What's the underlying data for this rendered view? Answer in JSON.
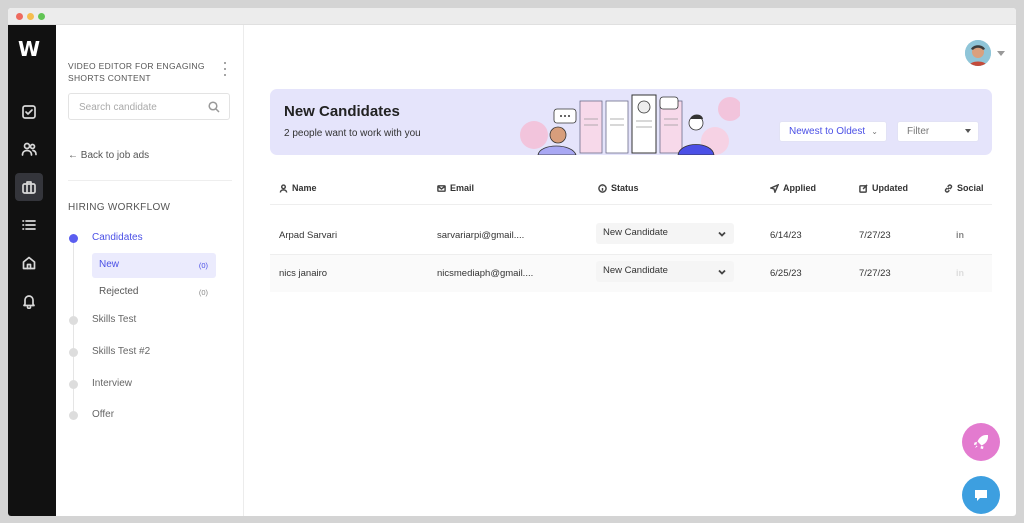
{
  "window": {
    "traffic_colors": [
      "#ee6a5f",
      "#f5bd4f",
      "#61c454"
    ]
  },
  "rail": {
    "logo": "W",
    "items": [
      {
        "icon": "checkbox-icon"
      },
      {
        "icon": "users-icon"
      },
      {
        "icon": "briefcase-icon",
        "active": true
      },
      {
        "icon": "list-icon"
      },
      {
        "icon": "home-icon"
      },
      {
        "icon": "bell-icon"
      }
    ]
  },
  "sidebar": {
    "job_title": "VIDEO EDITOR FOR ENGAGING SHORTS CONTENT",
    "search_placeholder": "Search candidate",
    "back_label": "Back to job ads",
    "workflow_heading": "HIRING WORKFLOW",
    "stages": [
      {
        "label": "Candidates",
        "active": true
      },
      {
        "label": "Skills Test"
      },
      {
        "label": "Skills Test #2"
      },
      {
        "label": "Interview"
      },
      {
        "label": "Offer"
      }
    ],
    "substages": [
      {
        "label": "New",
        "count": "(0)",
        "active": true
      },
      {
        "label": "Rejected",
        "count": "(0)"
      }
    ]
  },
  "banner": {
    "title": "New Candidates",
    "subtitle": "2 people want to work with you",
    "sort_label": "Newest to Oldest",
    "filter_label": "Filter"
  },
  "table": {
    "headers": {
      "name": "Name",
      "email": "Email",
      "status": "Status",
      "applied": "Applied",
      "updated": "Updated",
      "social": "Social"
    },
    "rows": [
      {
        "name": "Arpad Sarvari",
        "email": "sarvariarpi@gmail....",
        "status": "New Candidate",
        "applied": "6/14/23",
        "updated": "7/27/23",
        "social": "in"
      },
      {
        "name": "nics janairo",
        "email": "nicsmediaph@gmail....",
        "status": "New Candidate",
        "applied": "6/25/23",
        "updated": "7/27/23",
        "social": "in"
      }
    ]
  },
  "colors": {
    "accent": "#4b50e6",
    "banner_bg": "#e5e4fb",
    "rocket_fab": "#e37bcf",
    "chat_fab": "#3d9fe0"
  }
}
